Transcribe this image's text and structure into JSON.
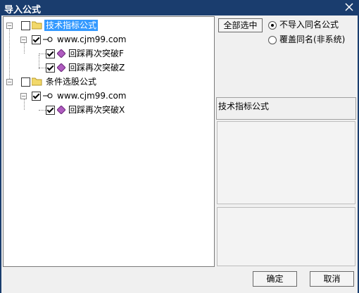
{
  "window": {
    "title": "导入公式",
    "close_glyph": "✕"
  },
  "tree": {
    "group1": {
      "label": "技术指标公式",
      "site": "www.cjm99.com",
      "items": [
        "回踩再次突破F",
        "回踩再次突破Z"
      ]
    },
    "group2": {
      "label": "条件选股公式",
      "site": "www.cjm99.com",
      "items": [
        "回踩再次突破X"
      ]
    }
  },
  "options": {
    "select_all": "全部选中",
    "radio1": "不导入同名公式",
    "radio2": "覆盖同名(非系统)",
    "selected": "radio1"
  },
  "detail": {
    "type_label": "技术指标公式"
  },
  "buttons": {
    "ok": "确定",
    "cancel": "取消"
  },
  "colors": {
    "titlebar": "#1a3d6e",
    "selection": "#3399ff",
    "formula_icon": "#b05cc0",
    "folder": "#f2d86a"
  }
}
